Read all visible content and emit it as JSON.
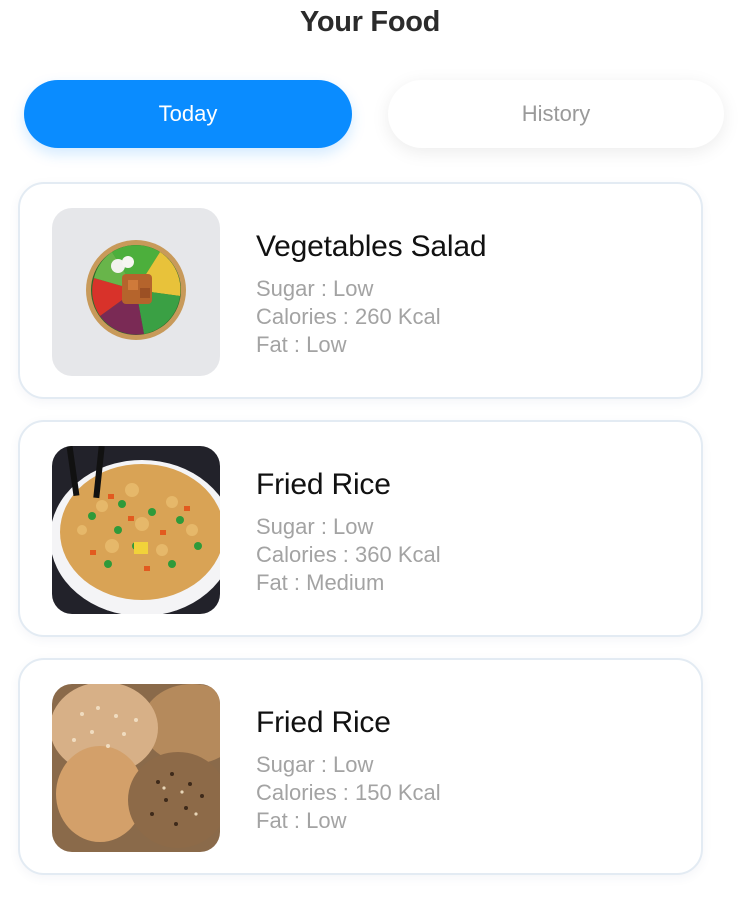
{
  "header": {
    "title": "Your Food"
  },
  "tabs": [
    {
      "label": "Today",
      "active": true
    },
    {
      "label": "History",
      "active": false
    }
  ],
  "colors": {
    "accent": "#0a8cff",
    "muted_text": "#a3a3a3",
    "card_border": "#e3ebf3"
  },
  "foods": [
    {
      "name": "Vegetables Salad",
      "image": "salad-bowl-image",
      "sugar": "Sugar : Low",
      "calories": "Calories : 260 Kcal",
      "fat": "Fat : Low"
    },
    {
      "name": "Fried Rice",
      "image": "fried-rice-image",
      "sugar": "Sugar : Low",
      "calories": "Calories : 360 Kcal",
      "fat": "Fat : Medium"
    },
    {
      "name": "Fried Rice",
      "image": "bread-rolls-image",
      "sugar": "Sugar : Low",
      "calories": "Calories : 150 Kcal",
      "fat": "Fat : Low"
    }
  ]
}
